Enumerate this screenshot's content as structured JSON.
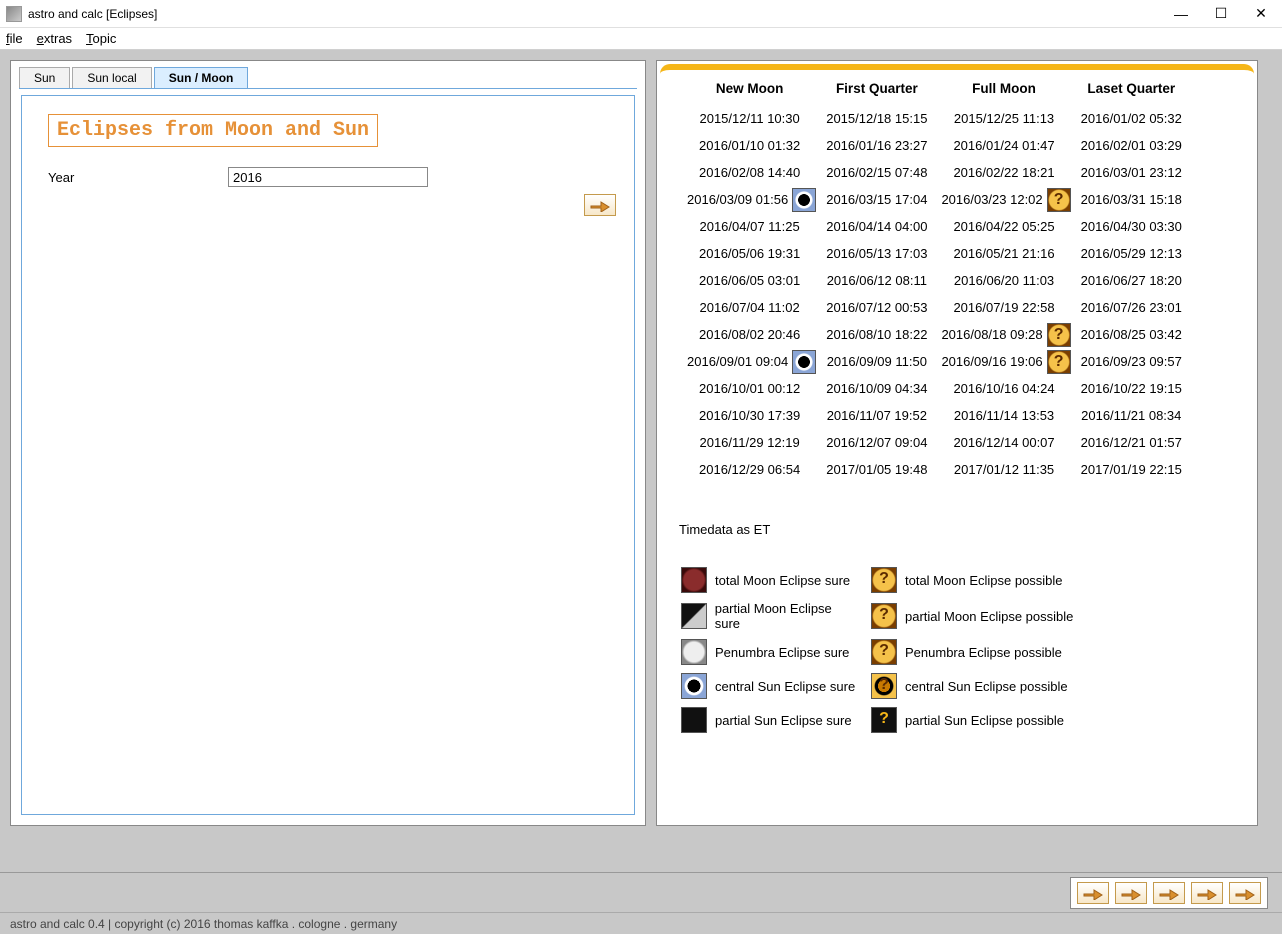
{
  "window": {
    "title": "astro and calc  [Eclipses]"
  },
  "menu": {
    "file": "file",
    "extras": "extras",
    "topic": "Topic"
  },
  "tabs": {
    "sun": "Sun",
    "sunlocal": "Sun local",
    "sunmoon": "Sun / Moon"
  },
  "left": {
    "heading": "Eclipses from Moon and Sun",
    "year_label": "Year",
    "year_value": "2016"
  },
  "moon": {
    "headers": [
      "New Moon",
      "First Quarter",
      "Full Moon",
      "Laset Quarter"
    ],
    "rows": [
      {
        "nm": "2015/12/11 10:30",
        "fq": "2015/12/18 15:15",
        "fm": "2015/12/25 11:13",
        "lq": "2016/01/02 05:32"
      },
      {
        "nm": "2016/01/10 01:32",
        "fq": "2016/01/16 23:27",
        "fm": "2016/01/24 01:47",
        "lq": "2016/02/01 03:29"
      },
      {
        "nm": "2016/02/08 14:40",
        "fq": "2016/02/15 07:48",
        "fm": "2016/02/22 18:21",
        "lq": "2016/03/01 23:12"
      },
      {
        "nm": "2016/03/09 01:56",
        "nm_ecl": "sun-central",
        "fq": "2016/03/15 17:04",
        "fm": "2016/03/23 12:02",
        "fm_ecl": "moon-possible",
        "lq": "2016/03/31 15:18"
      },
      {
        "nm": "2016/04/07 11:25",
        "fq": "2016/04/14 04:00",
        "fm": "2016/04/22 05:25",
        "lq": "2016/04/30 03:30"
      },
      {
        "nm": "2016/05/06 19:31",
        "fq": "2016/05/13 17:03",
        "fm": "2016/05/21 21:16",
        "lq": "2016/05/29 12:13"
      },
      {
        "nm": "2016/06/05 03:01",
        "fq": "2016/06/12 08:11",
        "fm": "2016/06/20 11:03",
        "lq": "2016/06/27 18:20"
      },
      {
        "nm": "2016/07/04 11:02",
        "fq": "2016/07/12 00:53",
        "fm": "2016/07/19 22:58",
        "lq": "2016/07/26 23:01"
      },
      {
        "nm": "2016/08/02 20:46",
        "fq": "2016/08/10 18:22",
        "fm": "2016/08/18 09:28",
        "fm_ecl": "moon-possible",
        "lq": "2016/08/25 03:42"
      },
      {
        "nm": "2016/09/01 09:04",
        "nm_ecl": "sun-central",
        "fq": "2016/09/09 11:50",
        "fm": "2016/09/16 19:06",
        "fm_ecl": "moon-possible",
        "lq": "2016/09/23 09:57"
      },
      {
        "nm": "2016/10/01 00:12",
        "fq": "2016/10/09 04:34",
        "fm": "2016/10/16 04:24",
        "lq": "2016/10/22 19:15"
      },
      {
        "nm": "2016/10/30 17:39",
        "fq": "2016/11/07 19:52",
        "fm": "2016/11/14 13:53",
        "lq": "2016/11/21 08:34"
      },
      {
        "nm": "2016/11/29 12:19",
        "fq": "2016/12/07 09:04",
        "fm": "2016/12/14 00:07",
        "lq": "2016/12/21 01:57"
      },
      {
        "nm": "2016/12/29 06:54",
        "fq": "2017/01/05 19:48",
        "fm": "2017/01/12 11:35",
        "lq": "2017/01/19 22:15"
      }
    ],
    "note": "Timedata as ET"
  },
  "legend": {
    "col1": [
      "total Moon Eclipse sure",
      "partial Moon Eclipse sure",
      "Penumbra Eclipse sure",
      "central Sun Eclipse sure",
      "partial Sun Eclipse sure"
    ],
    "col2": [
      "total Moon Eclipse possible",
      "partial Moon Eclipse possible",
      "Penumbra Eclipse possible",
      "central Sun Eclipse possible",
      "partial Sun Eclipse possible"
    ]
  },
  "status": "astro and calc 0.4 | copyright (c) 2016 thomas kaffka . cologne . germany"
}
